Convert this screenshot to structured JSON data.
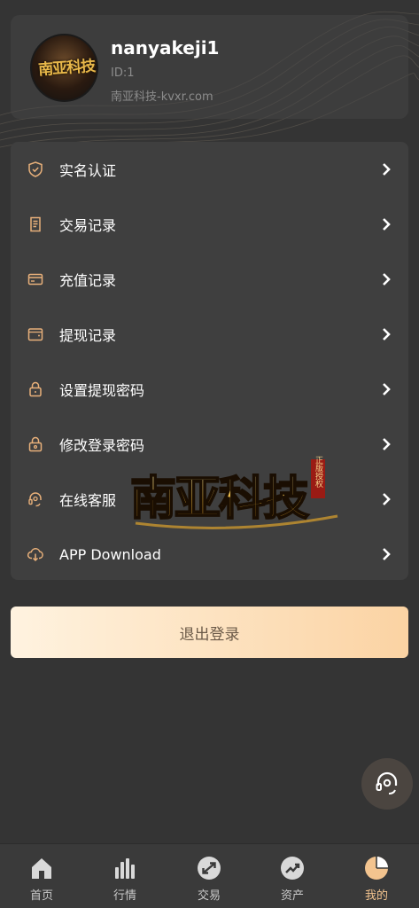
{
  "profile": {
    "username": "nanyakeji1",
    "id_text": "ID:1",
    "site_text": "南亚科技-kvxr.com",
    "avatar_text": "南亚科技"
  },
  "menu": {
    "items": [
      {
        "label": "实名认证",
        "icon": "shield-check-icon"
      },
      {
        "label": "交易记录",
        "icon": "receipt-icon"
      },
      {
        "label": "充值记录",
        "icon": "card-icon"
      },
      {
        "label": "提现记录",
        "icon": "wallet-icon"
      },
      {
        "label": "设置提现密码",
        "icon": "lock-icon"
      },
      {
        "label": "修改登录密码",
        "icon": "lock-edit-icon"
      },
      {
        "label": "在线客服",
        "icon": "headset-icon"
      },
      {
        "label": "APP Download",
        "icon": "cloud-download-icon"
      }
    ]
  },
  "watermark": {
    "text": "南亚科技",
    "small_text": "正版授权"
  },
  "logout_label": "退出登录",
  "tabbar": {
    "tabs": [
      {
        "label": "首页",
        "icon": "home-icon"
      },
      {
        "label": "行情",
        "icon": "bar-chart-icon"
      },
      {
        "label": "交易",
        "icon": "exchange-icon"
      },
      {
        "label": "资产",
        "icon": "trend-icon"
      },
      {
        "label": "我的",
        "icon": "pie-chart-icon"
      }
    ],
    "active": "我的"
  },
  "colors": {
    "background": "#343434",
    "card": "#3f3f3f",
    "accent": "#f3c48f",
    "icon_accent": "#e8b07a"
  }
}
